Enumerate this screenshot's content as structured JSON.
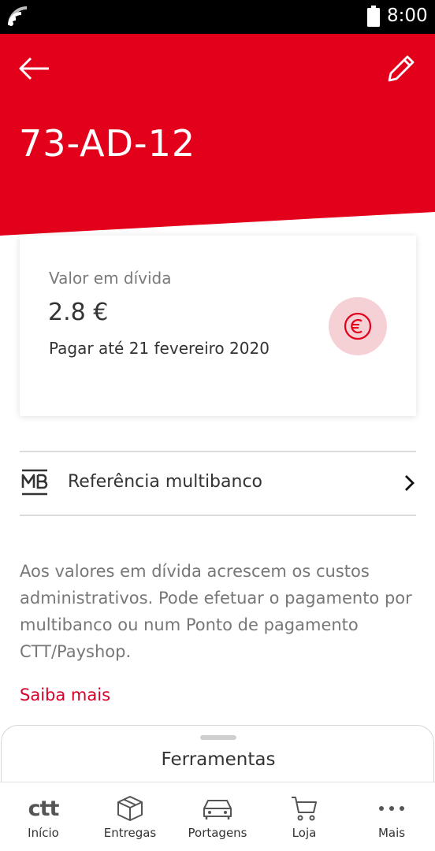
{
  "status_bar": {
    "time": "8:00"
  },
  "header": {
    "plate": "73-AD-12",
    "back_icon": "arrow-left-icon",
    "edit_icon": "pencil-icon",
    "color": "#e2001a"
  },
  "debt_card": {
    "label": "Valor em dívida",
    "amount": "2.8 €",
    "due": "Pagar até 21 fevereiro 2020",
    "pay_icon": "euro-icon",
    "accent": "#e2001a"
  },
  "multibanco": {
    "label": "Referência multibanco",
    "icon": "multibanco-icon"
  },
  "info": {
    "text": "Aos valores em dívida acrescem os custos administrativos. Pode efetuar o pagamento por multibanco ou num Ponto de pagamento CTT/Payshop.",
    "link": "Saiba mais"
  },
  "sheet": {
    "title": "Ferramentas"
  },
  "nav": {
    "items": [
      {
        "label": "Início",
        "icon": "ctt-logo",
        "logo_text": "ctt"
      },
      {
        "label": "Entregas",
        "icon": "package-icon"
      },
      {
        "label": "Portagens",
        "icon": "car-icon"
      },
      {
        "label": "Loja",
        "icon": "cart-icon"
      },
      {
        "label": "Mais",
        "icon": "more-icon"
      }
    ]
  }
}
